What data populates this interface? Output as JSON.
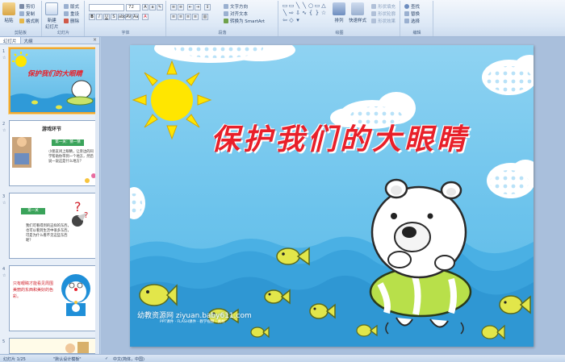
{
  "ribbon": {
    "clipboard": {
      "paste_label": "粘贴",
      "cut_label": "剪切",
      "copy_label": "复制",
      "format_painter_label": "格式刷",
      "group_label": "剪贴板"
    },
    "slides": {
      "new_slide_label": "新建\n幻灯片",
      "layout_label": "版式",
      "reset_label": "重设",
      "delete_label": "删除",
      "group_label": "幻灯片"
    },
    "font": {
      "font_size_value": "72",
      "group_label": "字体"
    },
    "paragraph": {
      "text_direction_label": "文字方向",
      "align_text_label": "对齐文本",
      "smartart_label": "转换为 SmartArt",
      "group_label": "段落"
    },
    "drawing": {
      "arrange_label": "排列",
      "quick_styles_label": "快速样式",
      "shape_fill_label": "形状填充",
      "shape_outline_label": "形状轮廓",
      "shape_effects_label": "形状效果",
      "group_label": "绘图"
    },
    "editing": {
      "find_label": "查找",
      "replace_label": "替换",
      "select_label": "选择",
      "group_label": "编辑"
    }
  },
  "panel": {
    "tab_slides": "幻灯片",
    "tab_outline": "大纲",
    "thumbs": [
      {
        "num": "1",
        "title": "保护我们的大眼睛"
      },
      {
        "num": "2",
        "title": "游戏环节",
        "chip": "第一关：猜一猜",
        "body": "小朋友闭上眼睛，让旁边的同学帮助你带到一个地方，然后说一说这是什么地方？"
      },
      {
        "num": "3",
        "chip": "第一关",
        "body": "我们可看得到的这样的东西，也可以看到生活中很多东西，可是为什么看不见这些东西呢？"
      },
      {
        "num": "4",
        "body": "只有眼睛才能看见周围美丽的东西和美好的色彩。"
      },
      {
        "num": "5"
      }
    ]
  },
  "slide": {
    "title": "保护我们的大眼睛",
    "watermark": "幼教资源网 ziyuan.baby611.com",
    "watermark_sub": "PPT课件 · FLASH课件 · 教学视频 · 素材"
  },
  "status": {
    "slide_count": "幻灯片 1/25",
    "theme": "\"默认设计模板\"",
    "language": "中文(简体，中国)"
  },
  "colors": {
    "accent_red": "#e8202a",
    "sky_blue": "#6cc3ec",
    "sun_yellow": "#ffe600",
    "fish_yellow": "#e2e64a"
  }
}
